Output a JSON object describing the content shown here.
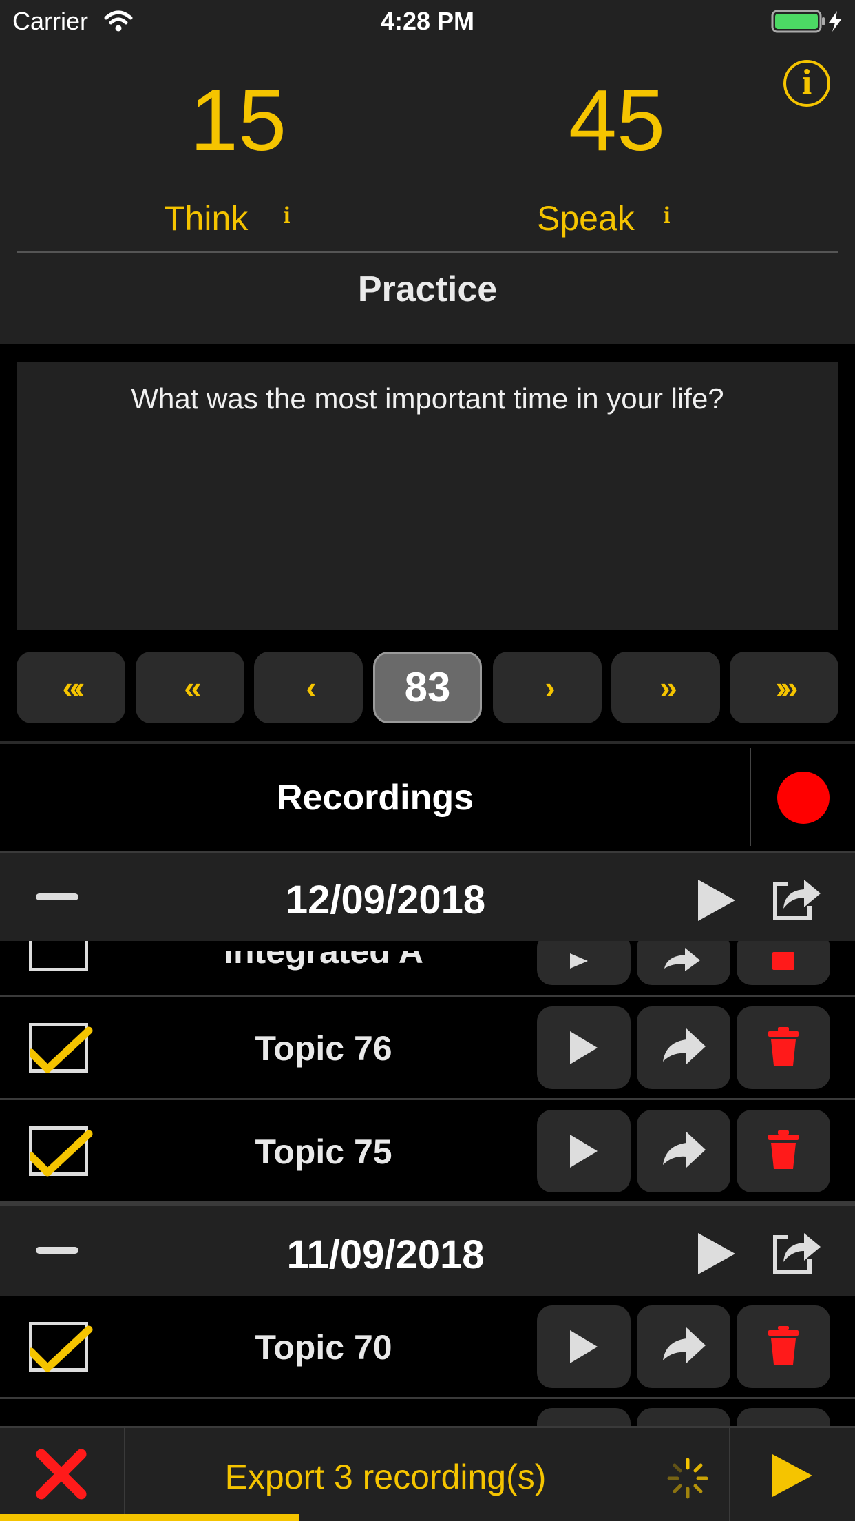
{
  "status_bar": {
    "carrier": "Carrier",
    "time": "4:28 PM"
  },
  "timer": {
    "think_value": "15",
    "speak_value": "45",
    "think_label": "Think",
    "speak_label": "Speak",
    "info_glyph": "i",
    "section_title": "Practice"
  },
  "question": {
    "text": "What was the most important time in your life?"
  },
  "nav": {
    "first": "«‹",
    "prev10": "«",
    "prev": "‹",
    "page": "83",
    "next": "›",
    "next10": "»",
    "last": "›»"
  },
  "recordings": {
    "title": "Recordings",
    "groups": [
      {
        "date": "12/09/2018"
      },
      {
        "date": "11/09/2018"
      }
    ],
    "rows": [
      {
        "title": "Integrated A",
        "checked": false
      },
      {
        "title": "Topic 76",
        "checked": true
      },
      {
        "title": "Topic 75",
        "checked": true
      },
      {
        "title": "Topic 70",
        "checked": true
      }
    ]
  },
  "export": {
    "label": "Export 3 recording(s)",
    "progress": 0.35
  },
  "colors": {
    "accent": "#f5c400",
    "record": "#ff0000",
    "delete": "#ff1a1a",
    "background": "#000000",
    "panel": "#222222"
  },
  "icons": [
    "wifi-icon",
    "battery-icon",
    "info-icon",
    "minus-icon",
    "play-icon",
    "share-icon",
    "forward-icon",
    "trash-icon",
    "checkbox-icon",
    "close-icon",
    "spinner-icon"
  ]
}
